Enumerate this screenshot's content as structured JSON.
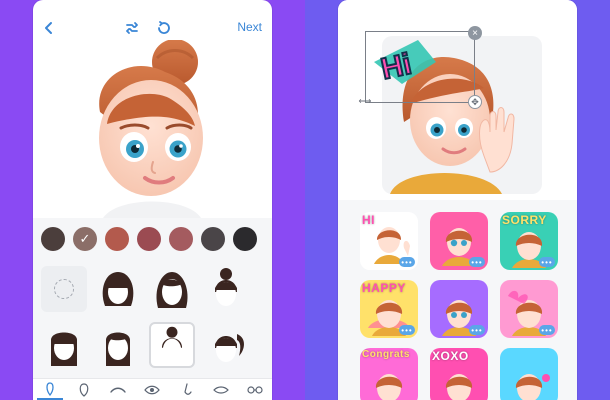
{
  "left_phone": {
    "nav": {
      "next_label": "Next",
      "back_icon": "chevron-left-icon",
      "shuffle_icon": "shuffle-icon",
      "undo_icon": "undo-icon"
    },
    "colors": {
      "accent": "#3a86d6",
      "swatches": [
        "#4b3e3c",
        "#8b6e68",
        "#b35a4d",
        "#9b4b52",
        "#a45b5f",
        "#4a4548",
        "#2b2a2d"
      ],
      "selected_index": 1
    },
    "hair_styles": [
      {
        "name": "none"
      },
      {
        "name": "long-wavy-bangs"
      },
      {
        "name": "long-wavy"
      },
      {
        "name": "bun-top"
      },
      {
        "name": "long-straight-bangs"
      },
      {
        "name": "long-straight"
      },
      {
        "name": "top-bun-selected"
      },
      {
        "name": "ponytail-bangs"
      }
    ],
    "tabs": [
      "face-tab",
      "head-shape-tab",
      "eyebrow-tab",
      "eye-tab",
      "nose-tab",
      "lips-tab",
      "glasses-tab"
    ]
  },
  "right_phone": {
    "sticker_text": "Hi",
    "stickers": [
      {
        "label": "HI",
        "bg": "#ffffff"
      },
      {
        "label": "",
        "bg": "#ff5fa8"
      },
      {
        "label": "SORRY",
        "bg": "#39d0b5"
      },
      {
        "label": "HAPPY",
        "bg": "#ffe16a"
      },
      {
        "label": "",
        "bg": "#a66cff"
      },
      {
        "label": "",
        "bg": "#ff9ad2"
      },
      {
        "label": "Congrats",
        "bg": "#ff6bd7"
      },
      {
        "label": "XOXO",
        "bg": "#ff4fb1"
      },
      {
        "label": "",
        "bg": "#5ad8ff"
      }
    ],
    "more_glyph": "•••"
  }
}
